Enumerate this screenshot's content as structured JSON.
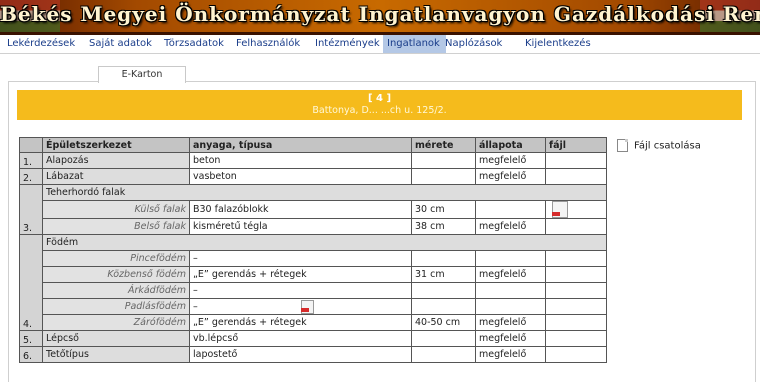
{
  "header": {
    "title": "Békés Megyei Önkormányzat Ingatlanvagyon Gazdálkodási Rendszer"
  },
  "nav": {
    "items": [
      {
        "label": "Lekérdezések"
      },
      {
        "label": "Saját adatok"
      },
      {
        "label": "Törzsadatok"
      },
      {
        "label": "Felhasználók"
      },
      {
        "label": "Intézmények"
      },
      {
        "label": "Ingatlanok",
        "active": true
      },
      {
        "label": "Naplózások"
      },
      {
        "label": "Kijelentkezés"
      }
    ]
  },
  "tab": {
    "label": "E-Karton"
  },
  "property": {
    "id": "[ 4 ]",
    "address": "Battonya, D... ...ch u. 125/2."
  },
  "table": {
    "headers": [
      "",
      "Épületszerkezet",
      "anyaga, típusa",
      "mérete",
      "állapota",
      "fájl"
    ],
    "rows": [
      {
        "num": "1.",
        "name": "Alapozás",
        "material": "beton",
        "size": "",
        "state": "megfelelő"
      },
      {
        "num": "2.",
        "name": "Lábazat",
        "material": "vasbeton",
        "size": "",
        "state": "megfelelő"
      },
      {
        "num": "3.",
        "name": "Teherhordó falak",
        "material": "",
        "size": "",
        "state": "",
        "header_row": true
      },
      {
        "num": "",
        "name": "Külső falak",
        "sub": true,
        "material": "B30 falazóblokk",
        "size": "30 cm",
        "state": "",
        "file": "pdf"
      },
      {
        "num": "",
        "name": "Belső falak",
        "sub": true,
        "material": "kisméretű tégla",
        "size": "38 cm",
        "state": "megfelelő"
      },
      {
        "num": "4.",
        "name": "Födém",
        "material": "",
        "size": "",
        "state": "",
        "header_row": true
      },
      {
        "num": "",
        "name": "Pincefödém",
        "sub": true,
        "material": "–",
        "size": "",
        "state": ""
      },
      {
        "num": "",
        "name": "Közbenső födém",
        "sub": true,
        "material": "„E” gerendás + rétegek",
        "size": "31 cm",
        "state": "megfelelő"
      },
      {
        "num": "",
        "name": "Árkádfödém",
        "sub": true,
        "material": "–",
        "size": "",
        "state": ""
      },
      {
        "num": "",
        "name": "Padlásfödém",
        "sub": true,
        "material": "–",
        "size": "",
        "state": "",
        "inline_pdf": true
      },
      {
        "num": "",
        "name": "Zárófödém",
        "sub": true,
        "material": "„E” gerendás + rétegek",
        "size": "40-50 cm",
        "state": "megfelelő"
      },
      {
        "num": "5.",
        "name": "Lépcső",
        "material": "vb.lépcső",
        "size": "",
        "state": "megfelelő"
      },
      {
        "num": "6.",
        "name": "Tetőtípus",
        "material": "lapostető",
        "size": "",
        "state": "megfelelő"
      }
    ]
  },
  "attach": {
    "label": "Fájl csatolása",
    "icon": "file-icon"
  }
}
